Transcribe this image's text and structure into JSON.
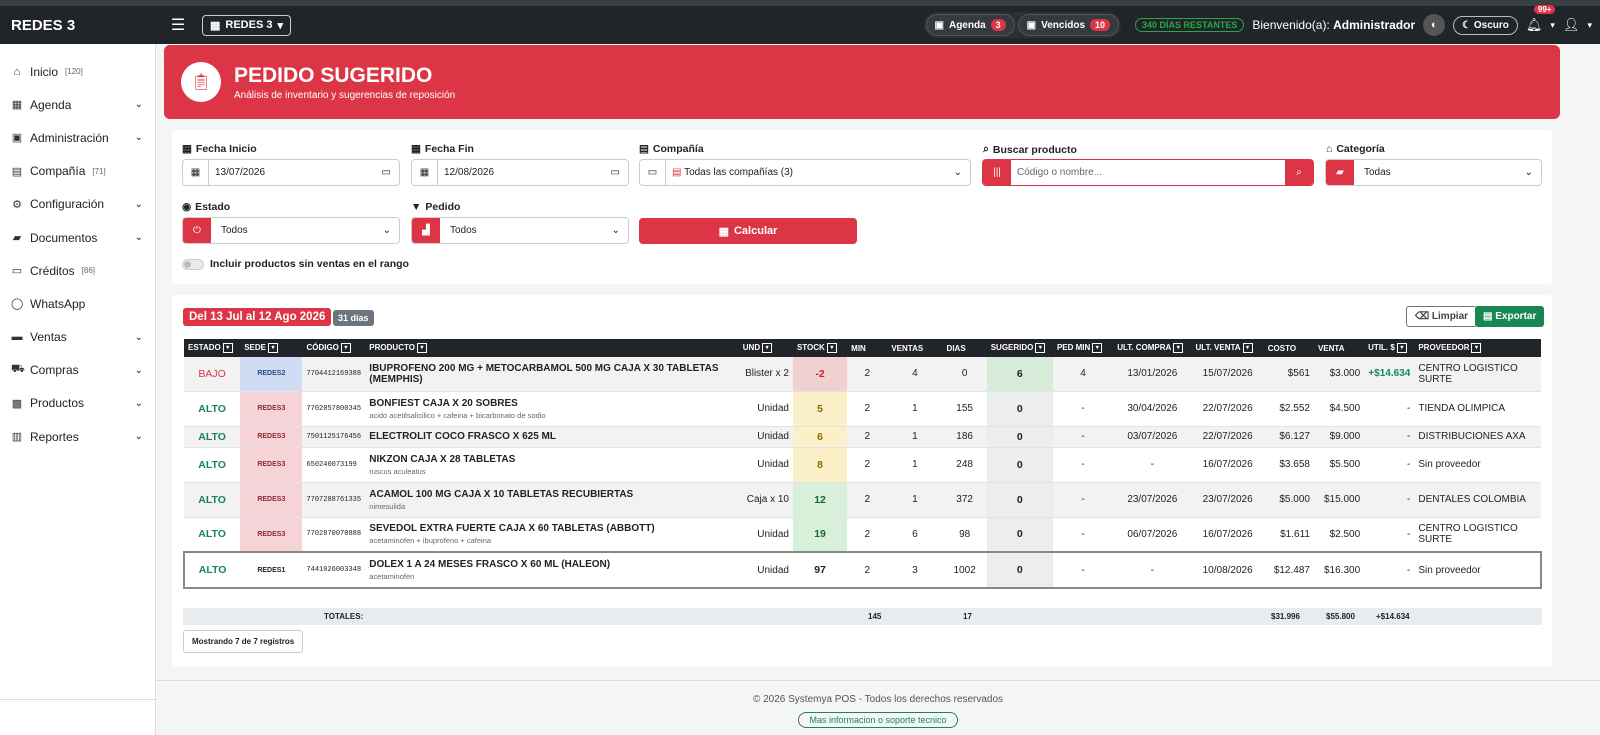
{
  "topbar": {
    "brand": "REDES 3",
    "company_selector": "REDES 3",
    "agenda_label": "Agenda",
    "agenda_count": "3",
    "vencidos_label": "Vencidos",
    "vencidos_count": "10",
    "days_remaining": "340 DÍAS RESTANTES",
    "welcome_prefix": "Bienvenido(a):",
    "welcome_user": "Administrador",
    "dark_mode_label": "Oscuro",
    "notifications_count": "99+"
  },
  "sidebar": {
    "items": [
      {
        "label": "Inicio",
        "badge": "[120]",
        "icon": "home-icon",
        "has_chevron": false
      },
      {
        "label": "Agenda",
        "badge": "",
        "icon": "calendar-icon",
        "has_chevron": true
      },
      {
        "label": "Administración",
        "badge": "",
        "icon": "id-card-icon",
        "has_chevron": true
      },
      {
        "label": "Compañía",
        "badge": "[71]",
        "icon": "building-icon",
        "has_chevron": false
      },
      {
        "label": "Configuración",
        "badge": "",
        "icon": "gears-icon",
        "has_chevron": true
      },
      {
        "label": "Documentos",
        "badge": "",
        "icon": "folder-icon",
        "has_chevron": true
      },
      {
        "label": "Créditos",
        "badge": "[86]",
        "icon": "credit-card-icon",
        "has_chevron": false
      },
      {
        "label": "WhatsApp",
        "badge": "",
        "icon": "whatsapp-icon",
        "has_chevron": false
      },
      {
        "label": "Ventas",
        "badge": "",
        "icon": "cash-icon",
        "has_chevron": true
      },
      {
        "label": "Compras",
        "badge": "",
        "icon": "cart-icon",
        "has_chevron": true
      },
      {
        "label": "Productos",
        "badge": "",
        "icon": "boxes-icon",
        "has_chevron": true
      },
      {
        "label": "Reportes",
        "badge": "",
        "icon": "chart-icon",
        "has_chevron": true
      }
    ]
  },
  "header": {
    "title": "PEDIDO SUGERIDO",
    "subtitle": "Análisis de inventario y sugerencias de reposición"
  },
  "filters": {
    "fecha_inicio_label": "Fecha Inicio",
    "fecha_inicio_value": "13/07/2026",
    "fecha_fin_label": "Fecha Fin",
    "fecha_fin_value": "12/08/2026",
    "compania_label": "Compañía",
    "compania_value": "Todas las compañías (3)",
    "buscar_label": "Buscar producto",
    "buscar_placeholder": "Código o nombre...",
    "categoria_label": "Categoría",
    "categoria_value": "Todas",
    "estado_label": "Estado",
    "estado_value": "Todos",
    "pedido_label": "Pedido",
    "pedido_value": "Todos",
    "calcular_label": "Calcular",
    "toggle_label": "Incluir productos sin ventas en el rango"
  },
  "results": {
    "range_label": "Del 13 Jul al 12 Ago 2026",
    "days_label": "31 días",
    "clear_label": "Limpiar",
    "export_label": "Exportar",
    "columns": [
      "ESTADO",
      "SEDE",
      "CÓDIGO",
      "PRODUCTO",
      "UND",
      "STOCK",
      "MIN",
      "VENTAS",
      "DIAS",
      "SUGERIDO",
      "PED MIN",
      "ULT. COMPRA",
      "ULT. VENTA",
      "COSTO",
      "VENTA",
      "UTIL. $",
      "PROVEEDOR"
    ],
    "rows": [
      {
        "estado": "BAJO",
        "sede": "REDES2",
        "codigo": "7704412169388",
        "producto": "IBUPROFENO 200 MG + METOCARBAMOL 500 MG CAJA X 30 TABLETAS (MEMPHIS)",
        "sub": "",
        "und": "Blister x 2",
        "stock": "-2",
        "min": "2",
        "ventas": "4",
        "dias": "0",
        "sugerido": "6",
        "pedmin": "4",
        "ult_compra": "13/01/2026",
        "ult_venta": "15/07/2026",
        "costo": "$561",
        "venta": "$3.000",
        "util": "+$14.634",
        "proveedor": "CENTRO LOGISTICO SURTE"
      },
      {
        "estado": "ALTO",
        "sede": "REDES3",
        "codigo": "7702057800345",
        "producto": "BONFIEST CAJA X 20 SOBRES",
        "sub": "acido acetilsalicilico + cafeina + bicarbonato de sodio",
        "und": "Unidad",
        "stock": "5",
        "min": "2",
        "ventas": "1",
        "dias": "155",
        "sugerido": "0",
        "pedmin": "-",
        "ult_compra": "30/04/2026",
        "ult_venta": "22/07/2026",
        "costo": "$2.552",
        "venta": "$4.500",
        "util": "-",
        "proveedor": "TIENDA OLIMPICA"
      },
      {
        "estado": "ALTO",
        "sede": "REDES3",
        "codigo": "7501125176456",
        "producto": "ELECTROLIT COCO FRASCO X 625 ML",
        "sub": "",
        "und": "Unidad",
        "stock": "6",
        "min": "2",
        "ventas": "1",
        "dias": "186",
        "sugerido": "0",
        "pedmin": "-",
        "ult_compra": "03/07/2026",
        "ult_venta": "22/07/2026",
        "costo": "$6.127",
        "venta": "$9.000",
        "util": "-",
        "proveedor": "DISTRIBUCIONES AXA"
      },
      {
        "estado": "ALTO",
        "sede": "REDES3",
        "codigo": "650240073199",
        "producto": "NIKZON CAJA X 28 TABLETAS",
        "sub": "ruscus aculeatus",
        "und": "Unidad",
        "stock": "8",
        "min": "2",
        "ventas": "1",
        "dias": "248",
        "sugerido": "0",
        "pedmin": "-",
        "ult_compra": "-",
        "ult_venta": "16/07/2026",
        "costo": "$3.658",
        "venta": "$5.500",
        "util": "-",
        "proveedor": "Sin proveedor"
      },
      {
        "estado": "ALTO",
        "sede": "REDES3",
        "codigo": "7707288761335",
        "producto": "ACAMOL 100 MG CAJA X 10 TABLETAS RECUBIERTAS",
        "sub": "nimesulida",
        "und": "Caja x 10",
        "stock": "12",
        "min": "2",
        "ventas": "1",
        "dias": "372",
        "sugerido": "0",
        "pedmin": "-",
        "ult_compra": "23/07/2026",
        "ult_venta": "23/07/2026",
        "costo": "$5.000",
        "venta": "$15.000",
        "util": "-",
        "proveedor": "DENTALES COLOMBIA"
      },
      {
        "estado": "ALTO",
        "sede": "REDES3",
        "codigo": "7702870070888",
        "producto": "SEVEDOL EXTRA FUERTE CAJA X 60 TABLETAS (ABBOTT)",
        "sub": "acetaminofen + ibuprofeno + cafeina",
        "und": "Unidad",
        "stock": "19",
        "min": "2",
        "ventas": "6",
        "dias": "98",
        "sugerido": "0",
        "pedmin": "-",
        "ult_compra": "06/07/2026",
        "ult_venta": "16/07/2026",
        "costo": "$1.611",
        "venta": "$2.500",
        "util": "-",
        "proveedor": "CENTRO LOGISTICO SURTE"
      },
      {
        "estado": "ALTO",
        "sede": "REDES1",
        "codigo": "7441026003348",
        "producto": "DOLEX 1 A 24 MESES FRASCO X 60 ML (HALEON)",
        "sub": "acetaminofen",
        "und": "Unidad",
        "stock": "97",
        "min": "2",
        "ventas": "3",
        "dias": "1002",
        "sugerido": "0",
        "pedmin": "-",
        "ult_compra": "-",
        "ult_venta": "10/08/2026",
        "costo": "$12.487",
        "venta": "$16.300",
        "util": "-",
        "proveedor": "Sin proveedor"
      }
    ],
    "totals": {
      "label": "TOTALES:",
      "ventas": "145",
      "sugerido": "17",
      "costo": "$31.996",
      "venta": "$55.800",
      "util": "+$14.634"
    },
    "showing": "Mostrando 7 de 7 registros"
  },
  "footer": {
    "copyright": "© 2026 Systemya POS - Todos los derechos reservados",
    "support": "Mas informacion o soporte tecnico"
  },
  "colors": {
    "accent": "#dc3545",
    "success": "#198754",
    "topbar": "#212529"
  }
}
